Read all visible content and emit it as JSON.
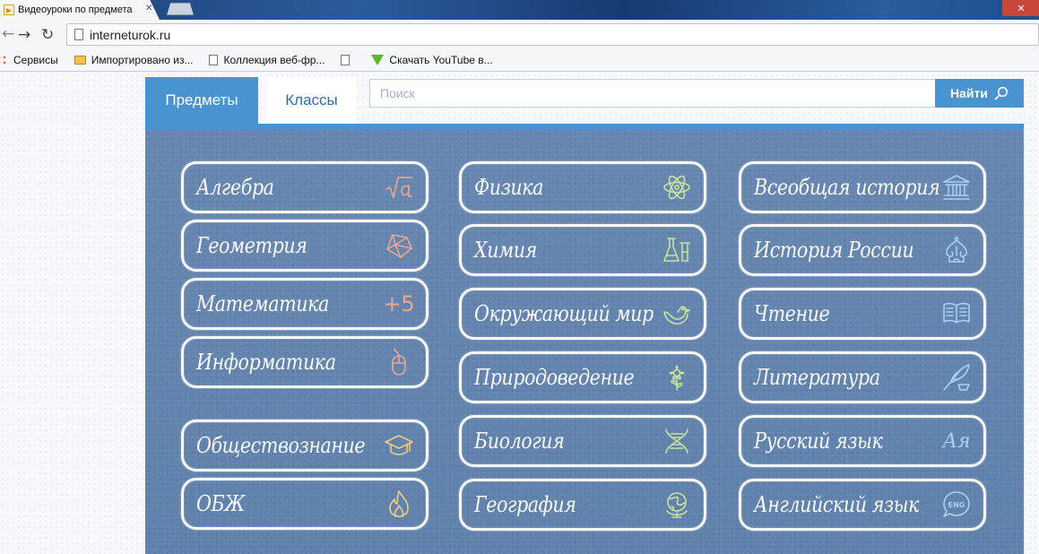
{
  "browser": {
    "tab_title": "Видеоуроки по предмета",
    "tab_close": "✕",
    "window_close": "✕",
    "url": "interneturok.ru",
    "back_glyph": "←",
    "forward_glyph": "→",
    "reload_glyph": "↻",
    "bookmarks": [
      {
        "label": "Сервисы",
        "icon": "apps-icon"
      },
      {
        "label": "Импортировано из...",
        "icon": "folder-icon"
      },
      {
        "label": "Коллекция веб-фр...",
        "icon": "page-icon"
      },
      {
        "label": "",
        "icon": "page-icon"
      },
      {
        "label": "Скачать YouTube в...",
        "icon": "download-icon"
      }
    ]
  },
  "header": {
    "tab_subjects": "Предметы",
    "tab_classes": "Классы",
    "search_placeholder": "Поиск",
    "search_button": "Найти"
  },
  "colors": {
    "accent": "#4a93d1",
    "board": "#6285b0",
    "salmon": "#f0a58e",
    "yellow": "#f2cd7a",
    "green": "#c8e39a",
    "blue": "#a9d0ef"
  },
  "subjects": {
    "col1": [
      {
        "name": "Алгебра",
        "icon": "sqrt-icon",
        "color": "salmon"
      },
      {
        "name": "Геометрия",
        "icon": "polyhedron-icon",
        "color": "salmon"
      },
      {
        "name": "Математика",
        "icon": "plus-five-icon",
        "color": "salmon",
        "glyph": "+5"
      },
      {
        "name": "Информатика",
        "icon": "mouse-icon",
        "color": "salmon"
      },
      {
        "name": "Обществознание",
        "icon": "graduation-cap-icon",
        "color": "yellow"
      },
      {
        "name": "ОБЖ",
        "icon": "flame-icon",
        "color": "yellow"
      }
    ],
    "col2": [
      {
        "name": "Физика",
        "icon": "atom-icon",
        "color": "green"
      },
      {
        "name": "Химия",
        "icon": "flask-icon",
        "color": "green"
      },
      {
        "name": "Окружающий мир",
        "icon": "bird-icon",
        "color": "green"
      },
      {
        "name": "Природоведение",
        "icon": "flower-icon",
        "color": "green"
      },
      {
        "name": "Биология",
        "icon": "dna-icon",
        "color": "green"
      },
      {
        "name": "География",
        "icon": "globe-icon",
        "color": "green"
      }
    ],
    "col3": [
      {
        "name": "Всеобщая история",
        "icon": "museum-icon",
        "color": "blue"
      },
      {
        "name": "История России",
        "icon": "dome-icon",
        "color": "blue"
      },
      {
        "name": "Чтение",
        "icon": "book-icon",
        "color": "blue"
      },
      {
        "name": "Литература",
        "icon": "quill-icon",
        "color": "blue"
      },
      {
        "name": "Русский язык",
        "icon": "letters-icon",
        "color": "blue",
        "glyph": "Ая"
      },
      {
        "name": "Английский язык",
        "icon": "eng-bubble-icon",
        "color": "blue",
        "glyph": "ENG"
      }
    ]
  }
}
